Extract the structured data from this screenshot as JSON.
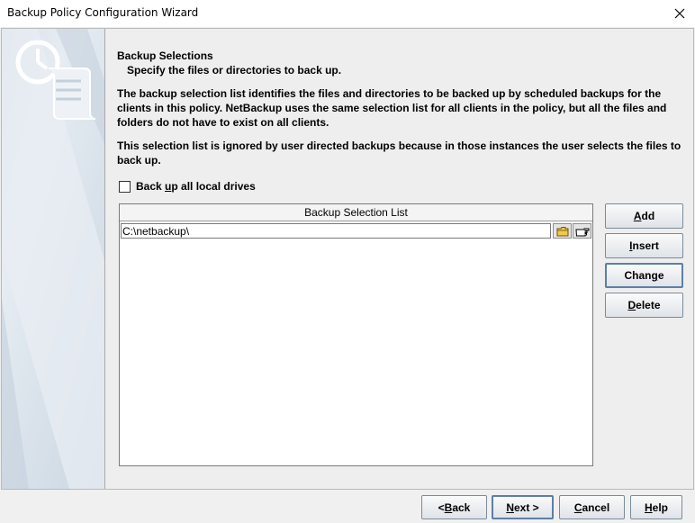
{
  "window": {
    "title": "Backup Policy Configuration Wizard",
    "close_icon": "close-icon"
  },
  "page": {
    "heading": "Backup Selections",
    "subheading": "Specify the files or directories to back up.",
    "description1": "The backup selection list identifies the files and directories to be backed up by scheduled backups for the clients in this policy. NetBackup uses the same selection list for all clients in the policy, but all the files and folders do not have to exist on all clients.",
    "description2": "This selection list is ignored by user directed backups because in those instances the user selects the files to back up."
  },
  "checkbox": {
    "label_pre": "Back ",
    "label_ul": "u",
    "label_post": "p all local drives",
    "checked": false
  },
  "selection_list": {
    "header": "Backup Selection List",
    "rows": [
      {
        "value": "C:\\netbackup\\",
        "browse_icon": "folder-icon",
        "select_icon": "pointing-hand-icon"
      }
    ]
  },
  "side_buttons": {
    "add": {
      "ul": "A",
      "rest": "dd"
    },
    "insert": {
      "ul": "I",
      "rest": "nsert"
    },
    "change": {
      "pre": "Chan",
      "ul": "g",
      "rest": "e"
    },
    "delete": {
      "ul": "D",
      "rest": "elete"
    }
  },
  "nav_buttons": {
    "back": {
      "pre": "< ",
      "ul": "B",
      "rest": "ack"
    },
    "next": {
      "ul": "N",
      "rest": "ext >"
    },
    "cancel": {
      "ul": "C",
      "rest": "ancel"
    },
    "help": {
      "ul": "H",
      "rest": "elp"
    }
  },
  "colors": {
    "sidebar_top": "#d7e0ea",
    "focus_border": "#5d7fa6",
    "folder_yellow": "#f2c94c"
  }
}
